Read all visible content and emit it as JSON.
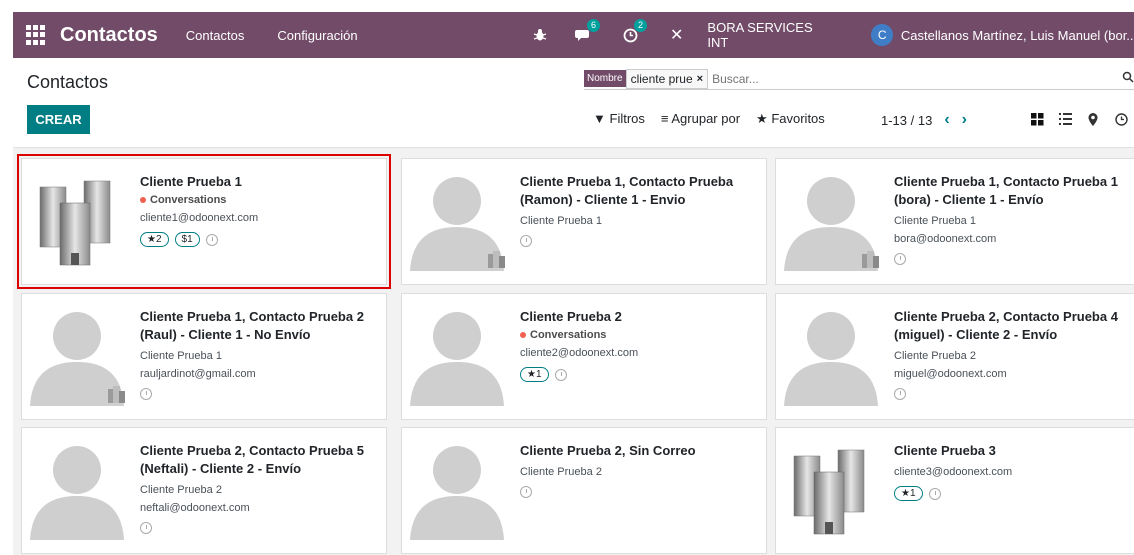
{
  "app": {
    "title": "Contactos",
    "menu": [
      "Contactos",
      "Configuración"
    ],
    "company": "BORA SERVICES INT",
    "user_initial": "C",
    "user_name": "Castellanos Martínez, Luis Manuel (bor..."
  },
  "systray": {
    "bug_icon": "bug-icon",
    "chat_badge": "6",
    "activity_badge": "2",
    "close_icon": "close-icon"
  },
  "control": {
    "page_title": "Contactos",
    "create_label": "CREAR",
    "search": {
      "facet_label": "Nombre",
      "facet_value": "cliente prue",
      "facet_remove": "×",
      "placeholder": "Buscar..."
    },
    "filters_label": "Filtros",
    "group_label": "Agrupar por",
    "favorites_label": "Favoritos",
    "pager": "1-13 / 13"
  },
  "cards": [
    {
      "title": "Cliente Prueba 1",
      "tag": "Conversations",
      "lines": [
        "cliente1@odoonext.com"
      ],
      "pills": [
        "★2",
        "$1"
      ],
      "image": "company"
    },
    {
      "title": "Cliente Prueba 1, Contacto Prueba (Ramon) - Cliente 1 - Envio",
      "lines": [
        "Cliente Prueba 1"
      ],
      "image": "person-company"
    },
    {
      "title": "Cliente Prueba 1, Contacto Prueba 1 (bora) - Cliente 1 - Envío",
      "lines": [
        "Cliente Prueba 1",
        "bora@odoonext.com"
      ],
      "image": "person-company"
    },
    {
      "title": "Cliente Prueba 1, Contacto Prueba 2 (Raul) - Cliente 1 - No Envío",
      "lines": [
        "Cliente Prueba 1",
        "rauljardinot@gmail.com"
      ],
      "image": "person-company"
    },
    {
      "title": "Cliente Prueba 2",
      "tag": "Conversations",
      "lines": [
        "cliente2@odoonext.com"
      ],
      "pills": [
        "★1"
      ],
      "image": "person"
    },
    {
      "title": "Cliente Prueba 2, Contacto Prueba 4 (miguel) - Cliente 2 - Envío",
      "lines": [
        "Cliente Prueba 2",
        "miguel@odoonext.com"
      ],
      "image": "person-person"
    },
    {
      "title": "Cliente Prueba 2, Contacto Prueba 5 (Neftali) - Cliente 2 - Envío",
      "lines": [
        "Cliente Prueba 2",
        "neftali@odoonext.com"
      ],
      "image": "person-person"
    },
    {
      "title": "Cliente Prueba 2, Sin Correo",
      "lines": [
        "Cliente Prueba 2"
      ],
      "image": "person-person"
    },
    {
      "title": "Cliente Prueba 3",
      "lines": [
        "cliente3@odoonext.com"
      ],
      "pills": [
        "★1"
      ],
      "image": "company"
    }
  ]
}
